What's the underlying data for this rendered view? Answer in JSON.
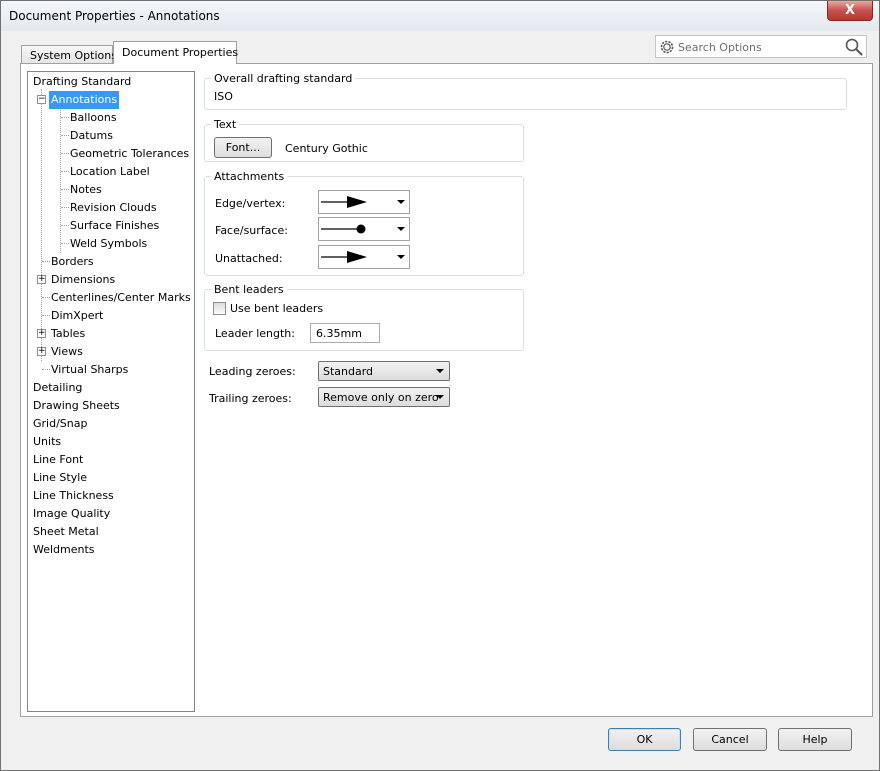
{
  "window": {
    "title": "Document Properties - Annotations",
    "close_label": "X"
  },
  "tabs": [
    {
      "label": "System Options"
    },
    {
      "label": "Document Properties"
    }
  ],
  "search": {
    "placeholder": "Search Options",
    "icons": [
      "gear-icon",
      "magnifier-icon"
    ]
  },
  "tree": {
    "items": [
      "Drafting Standard",
      "Annotations",
      "Balloons",
      "Datums",
      "Geometric Tolerances",
      "Location Label",
      "Notes",
      "Revision Clouds",
      "Surface Finishes",
      "Weld Symbols",
      "Borders",
      "Dimensions",
      "Centerlines/Center Marks",
      "DimXpert",
      "Tables",
      "Views",
      "Virtual Sharps",
      "Detailing",
      "Drawing Sheets",
      "Grid/Snap",
      "Units",
      "Line Font",
      "Line Style",
      "Line Thickness",
      "Image Quality",
      "Sheet Metal",
      "Weldments"
    ],
    "selected": "Annotations"
  },
  "overall": {
    "title": "Overall drafting standard",
    "value": "ISO"
  },
  "text_group": {
    "title": "Text",
    "font_button": "Font...",
    "font_name": "Century Gothic"
  },
  "attachments": {
    "title": "Attachments",
    "edge_label": "Edge/vertex:",
    "face_label": "Face/surface:",
    "unattached_label": "Unattached:",
    "edge_style": "filled-arrow",
    "face_style": "filled-dot",
    "unattached_style": "filled-arrow"
  },
  "bent_leaders": {
    "title": "Bent leaders",
    "checkbox_label": "Use bent leaders",
    "checked": false,
    "length_label": "Leader length:",
    "length_value": "6.35mm"
  },
  "leading_zeroes": {
    "label": "Leading zeroes:",
    "value": "Standard"
  },
  "trailing_zeroes": {
    "label": "Trailing zeroes:",
    "value": "Remove only on zero"
  },
  "footer": {
    "ok": "OK",
    "cancel": "Cancel",
    "help": "Help"
  },
  "colors": {
    "selection": "#3399ff",
    "window_bg": "#f0f0f0",
    "close_button": "#c75050"
  }
}
